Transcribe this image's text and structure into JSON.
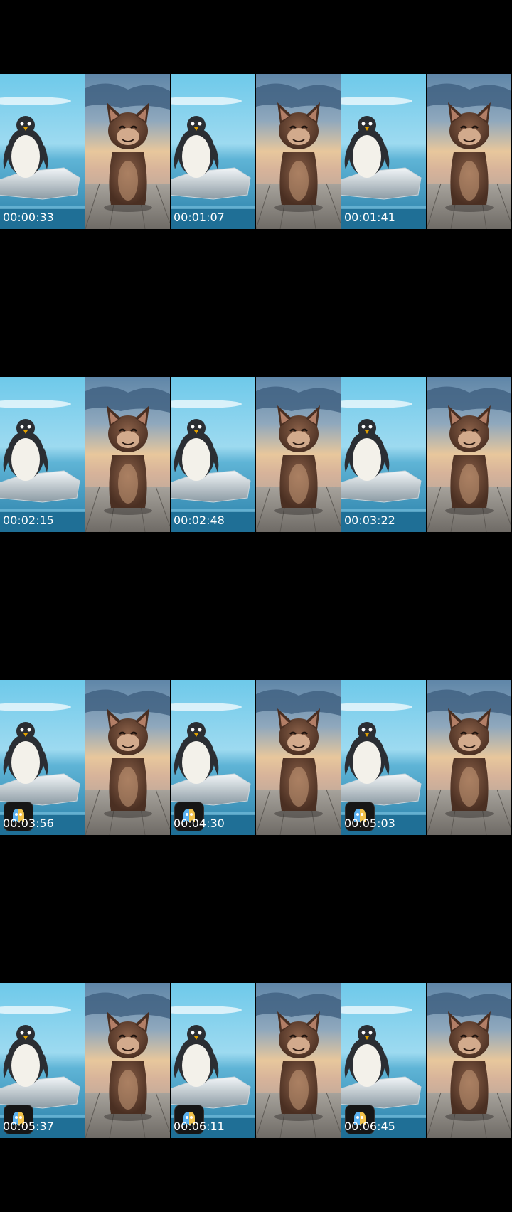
{
  "rows": [
    {
      "timestamps": [
        "00:00:33",
        "00:01:07",
        "00:01:41"
      ]
    },
    {
      "timestamps": [
        "00:02:15",
        "00:02:48",
        "00:03:22"
      ]
    },
    {
      "timestamps": [
        "00:03:56",
        "00:04:30",
        "00:05:03"
      ]
    },
    {
      "timestamps": [
        "00:05:37",
        "00:06:11",
        "00:06:45"
      ]
    }
  ],
  "frames": [
    [
      "penguin-on-iceberg",
      "cat-on-dock",
      "penguin-on-iceberg",
      "cat-on-dock",
      "penguin-on-iceberg",
      "cat-on-dock"
    ],
    [
      "penguin-on-iceberg",
      "cat-on-dock",
      "penguin-on-iceberg",
      "cat-on-dock",
      "penguin-on-iceberg",
      "cat-on-dock"
    ],
    [
      "penguin-on-iceberg",
      "cat-on-dock",
      "penguin-on-iceberg",
      "cat-on-dock",
      "penguin-on-iceberg",
      "cat-on-dock"
    ],
    [
      "penguin-on-iceberg",
      "cat-on-dock",
      "penguin-on-iceberg",
      "cat-on-dock",
      "penguin-on-iceberg",
      "cat-on-dock"
    ]
  ],
  "badge_icons": [
    "",
    "",
    "app-logo-icon",
    "app-logo-icon"
  ]
}
